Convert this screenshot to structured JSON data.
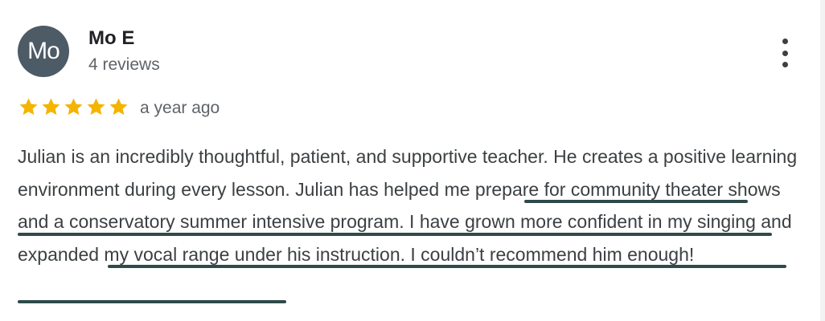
{
  "review": {
    "avatar_initials": "Mo",
    "author_name": "Mo E",
    "author_reviews": "4 reviews",
    "rating": 5,
    "rating_max": 5,
    "time_ago": "a year ago",
    "text": "Julian is an incredibly thoughtful, patient, and supportive teacher. He creates a positive learning environment during every lesson. Julian has helped me prepare for community theater shows and a conservatory summer intensive program. I have grown more confident in my singing and expanded my vocal range under his instruction. I couldn’t recommend him enough!"
  },
  "icons": {
    "more": "more-vert-icon",
    "star": "star-icon"
  },
  "colors": {
    "star": "#f4b400",
    "avatar_bg": "#4d5b66",
    "underline": "#2f4a4a",
    "text": "#3c4043",
    "secondary_text": "#5f6368"
  }
}
